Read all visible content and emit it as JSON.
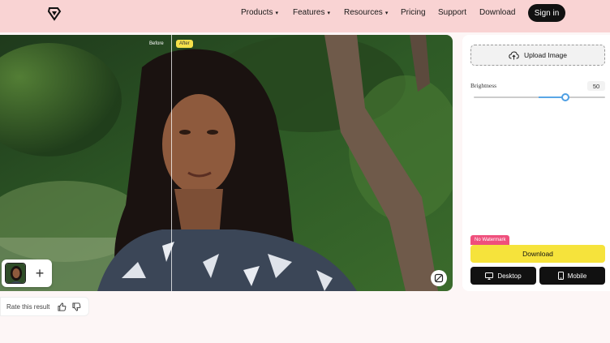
{
  "nav": {
    "items": [
      {
        "label": "Products",
        "has_caret": true
      },
      {
        "label": "Features",
        "has_caret": true
      },
      {
        "label": "Resources",
        "has_caret": true
      },
      {
        "label": "Pricing",
        "has_caret": false
      },
      {
        "label": "Support",
        "has_caret": false
      },
      {
        "label": "Download",
        "has_caret": false
      }
    ],
    "signin_label": "Sign in",
    "caret_glyph": "▾"
  },
  "stage": {
    "before_label": "Before",
    "after_label": "After",
    "add_label": "+"
  },
  "rate": {
    "label": "Rate this result"
  },
  "panel": {
    "upload_label": "Upload Image",
    "brightness_label": "Brightness",
    "brightness_value": "50",
    "brightness_fraction": 0.5,
    "badge_label": "No Watermark",
    "download_label": "Download",
    "desktop_label": "Desktop",
    "mobile_label": "Mobile"
  },
  "colors": {
    "topbar": "#f9d3d3",
    "accent_yellow": "#f6e33b",
    "badge_pink": "#ef4f7c",
    "slider_blue": "#4e9fe3"
  },
  "icons": [
    "logo-icon",
    "upload-cloud-icon",
    "compare-icon",
    "thumbs-up-icon",
    "thumbs-down-icon",
    "desktop-icon",
    "mobile-icon"
  ]
}
